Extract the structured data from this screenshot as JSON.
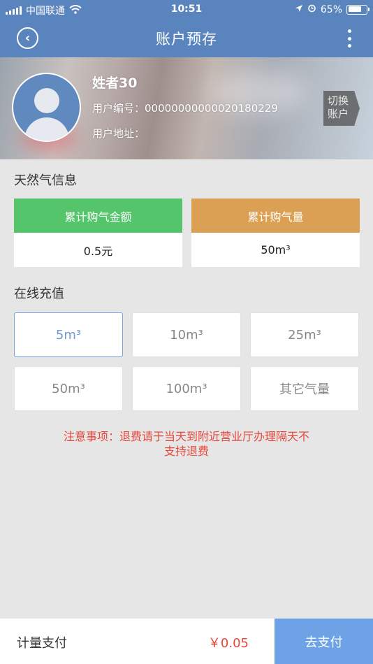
{
  "status": {
    "carrier": "中国联通",
    "time": "10:51",
    "battery": "65%"
  },
  "nav": {
    "title": "账户预存"
  },
  "profile": {
    "name": "姓者30",
    "id_label": "用户编号：",
    "id_value": "00000000000020180229",
    "address_label": "用户地址：",
    "address_value": "",
    "switch_label_1": "切换",
    "switch_label_2": "账户"
  },
  "gas_info": {
    "title": "天然气信息",
    "amount_label": "累计购气金额",
    "amount_value": "0.5元",
    "amount_color": "#54c56b",
    "volume_label": "累计购气量",
    "volume_value": "50m³",
    "volume_color": "#dba053"
  },
  "recharge": {
    "title": "在线充值",
    "options": [
      "5m³",
      "10m³",
      "25m³",
      "50m³",
      "100m³",
      "其它气量"
    ],
    "selected": "5m³"
  },
  "notice": {
    "line1": "注意事项：退费请于当天到附近营业厅办理隔天不",
    "line2": "支持退费"
  },
  "footer": {
    "label": "计量支付",
    "amount": "￥0.05",
    "pay_button": "去支付"
  }
}
